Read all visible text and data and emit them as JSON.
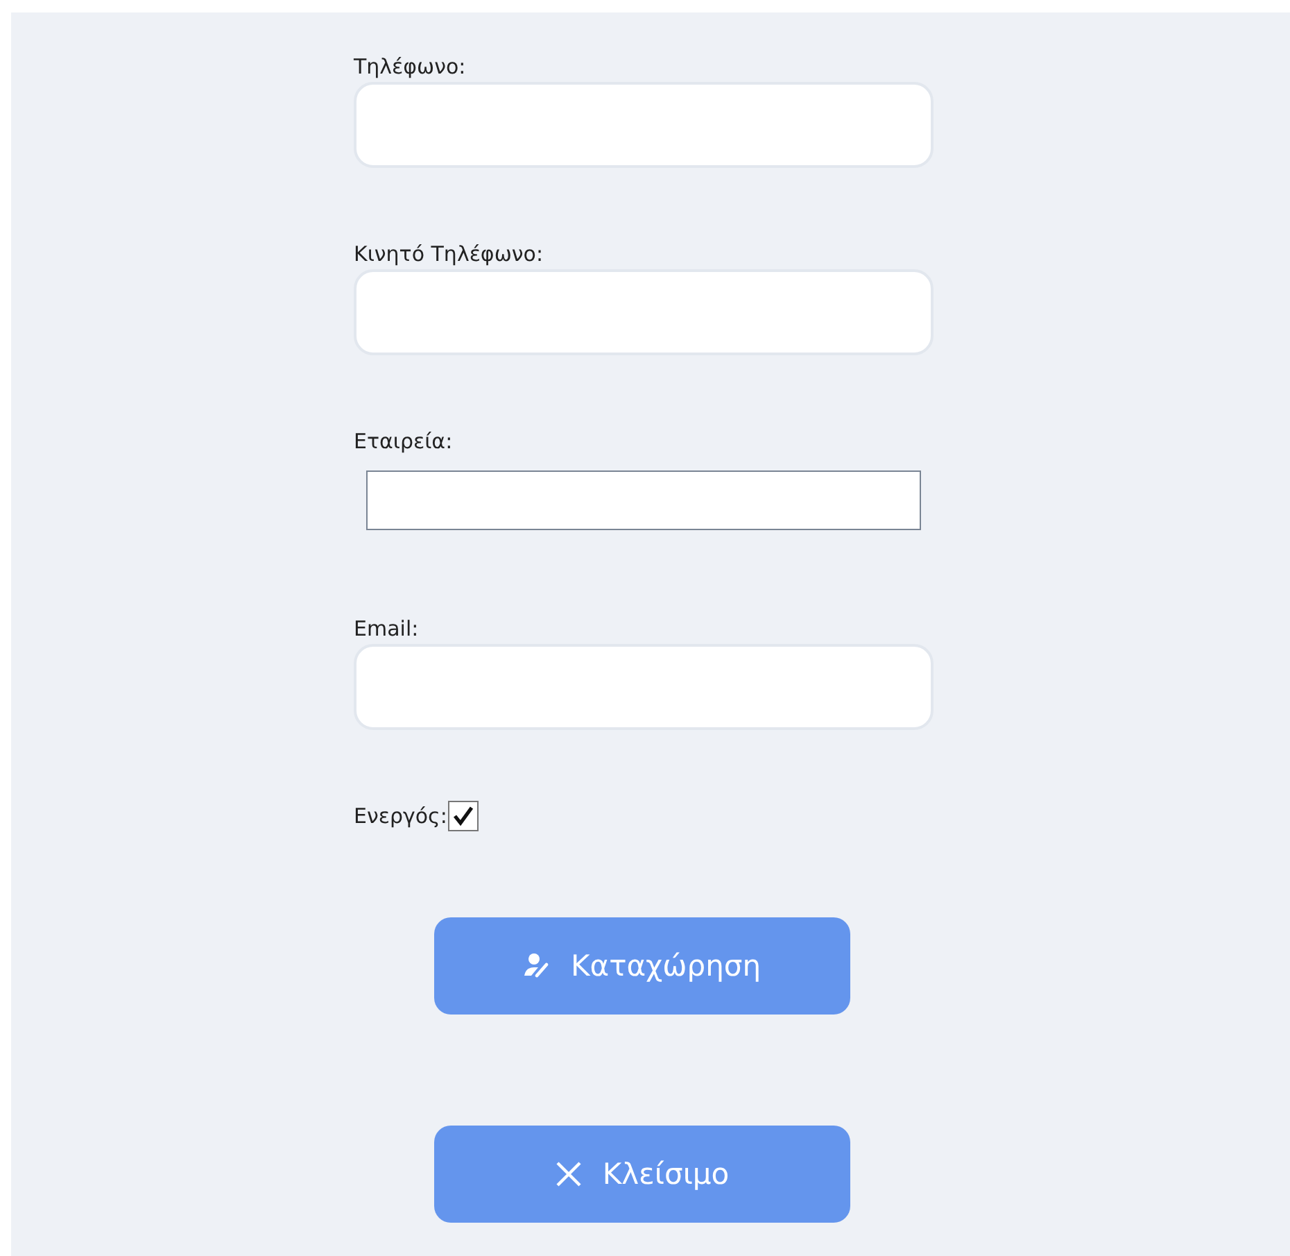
{
  "fields": [
    {
      "label": "Τηλέφωνο:",
      "kind": "rounded"
    },
    {
      "label": "Κινητό Τηλέφωνο:",
      "kind": "rounded"
    },
    {
      "label": "Εταιρεία:",
      "kind": "plain"
    },
    {
      "label": "Email:",
      "kind": "rounded"
    }
  ],
  "active": {
    "label": "Ενεργός:",
    "checked": true
  },
  "buttons": [
    {
      "label": "Καταχώρηση",
      "kind": "submit"
    },
    {
      "label": "Κλείσιμο",
      "kind": "close"
    }
  ]
}
